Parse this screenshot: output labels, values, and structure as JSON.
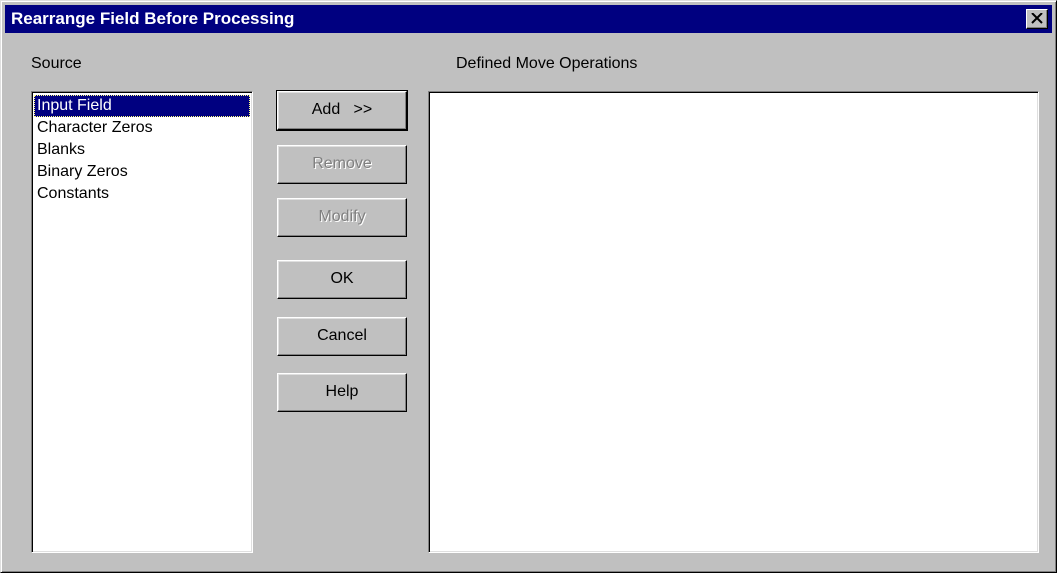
{
  "window": {
    "title": "Rearrange Field Before Processing",
    "close_icon": "close-x-icon"
  },
  "source": {
    "label": "Source",
    "items": [
      {
        "label": "Input Field",
        "selected": true
      },
      {
        "label": "Character Zeros",
        "selected": false
      },
      {
        "label": "Blanks",
        "selected": false
      },
      {
        "label": "Binary Zeros",
        "selected": false
      },
      {
        "label": "Constants",
        "selected": false
      }
    ]
  },
  "moves": {
    "label": "Defined Move Operations",
    "items": []
  },
  "buttons": {
    "add": "Add   >>",
    "remove": "Remove",
    "modify": "Modify",
    "ok": "OK",
    "cancel": "Cancel",
    "help": "Help"
  },
  "colors": {
    "titlebar": "#000080",
    "face": "#c0c0c0",
    "selection": "#000080",
    "disabled_text": "#808080"
  }
}
